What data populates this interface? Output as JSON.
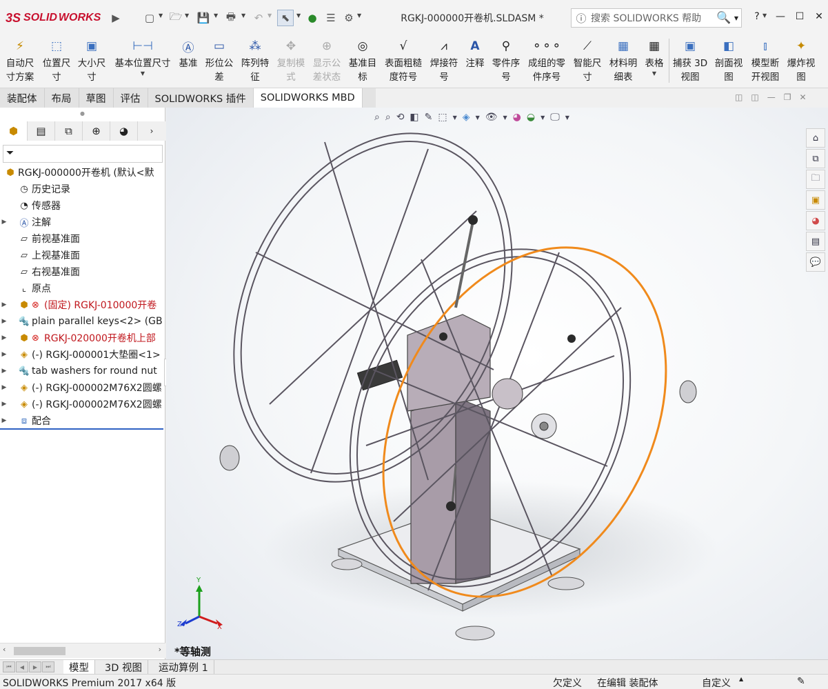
{
  "app": {
    "brand_ds": "3S",
    "brand_solid": "SOLID",
    "brand_works": "WORKS"
  },
  "titlebar": {
    "document_title": "RGKJ-000000开卷机.SLDASM *",
    "search_placeholder": "搜索 SOLIDWORKS 帮助",
    "help_label": "?",
    "icons": [
      "new-document",
      "open",
      "save",
      "print",
      "undo",
      "select",
      "rebuild",
      "file-properties",
      "options"
    ]
  },
  "ribbon": {
    "buttons": [
      {
        "label": "自动尺\n寸方案",
        "icon": "auto-dimension-icon"
      },
      {
        "label": "位置尺\n寸",
        "icon": "location-dimension-icon"
      },
      {
        "label": "大小尺\n寸",
        "icon": "size-dimension-icon"
      },
      {
        "label": "基本位置尺寸",
        "icon": "basic-location-dimension-icon"
      },
      {
        "label": "基准",
        "icon": "datum-icon"
      },
      {
        "label": "形位公\n差",
        "icon": "geometric-tolerance-icon"
      },
      {
        "label": "阵列特\n征",
        "icon": "pattern-feature-icon"
      },
      {
        "label": "复制模\n式",
        "icon": "copy-scheme-icon"
      },
      {
        "label": "显示公\n差状态",
        "icon": "show-tolerance-status-icon"
      },
      {
        "label": "基准目\n标",
        "icon": "datum-target-icon"
      },
      {
        "label": "表面粗糙\n度符号",
        "icon": "surface-finish-icon"
      },
      {
        "label": "焊接符\n号",
        "icon": "weld-symbol-icon"
      },
      {
        "label": "注释",
        "icon": "note-icon"
      },
      {
        "label": "零件序\n号",
        "icon": "balloon-icon"
      },
      {
        "label": "成组的零\n件序号",
        "icon": "stacked-balloon-icon"
      },
      {
        "label": "智能尺\n寸",
        "icon": "smart-dimension-icon"
      },
      {
        "label": "材料明\n细表",
        "icon": "bom-icon"
      },
      {
        "label": "表格",
        "icon": "table-icon"
      },
      {
        "label": "捕获 3D\n视图",
        "icon": "capture-3d-view-icon"
      },
      {
        "label": "剖面视\n图",
        "icon": "section-view-icon"
      },
      {
        "label": "模型断\n开视图",
        "icon": "model-break-view-icon"
      },
      {
        "label": "爆炸视\n图",
        "icon": "exploded-view-icon"
      }
    ]
  },
  "command_tabs": [
    "装配体",
    "布局",
    "草图",
    "评估",
    "SOLIDWORKS 插件",
    "SOLIDWORKS MBD"
  ],
  "active_command_tab": "SOLIDWORKS MBD",
  "feature_tree": {
    "root": "RGKJ-000000开卷机  (默认<默",
    "items": [
      {
        "label": "历史记录",
        "expandable": false,
        "icon": "history-icon"
      },
      {
        "label": "传感器",
        "expandable": false,
        "icon": "sensor-icon"
      },
      {
        "label": "注解",
        "expandable": true,
        "icon": "annotations-icon"
      },
      {
        "label": "前视基准面",
        "expandable": false,
        "icon": "plane-icon"
      },
      {
        "label": "上视基准面",
        "expandable": false,
        "icon": "plane-icon"
      },
      {
        "label": "右视基准面",
        "expandable": false,
        "icon": "plane-icon"
      },
      {
        "label": "原点",
        "expandable": false,
        "icon": "origin-icon"
      },
      {
        "label": "(固定) RGKJ-010000开卷",
        "expandable": true,
        "icon": "assembly-icon",
        "error": true
      },
      {
        "label": "plain parallel keys<2> (GB",
        "expandable": true,
        "icon": "toolbox-part-icon"
      },
      {
        "label": "RGKJ-020000开卷机上部",
        "expandable": true,
        "icon": "assembly-icon",
        "error": true
      },
      {
        "label": "(-) RGKJ-000001大垫圈<1>",
        "expandable": true,
        "icon": "part-icon"
      },
      {
        "label": "tab washers for round nut",
        "expandable": true,
        "icon": "toolbox-part-icon"
      },
      {
        "label": "(-) RGKJ-000002M76X2圆螺",
        "expandable": true,
        "icon": "part-icon"
      },
      {
        "label": "(-) RGKJ-000002M76X2圆螺",
        "expandable": true,
        "icon": "part-icon"
      },
      {
        "label": "配合",
        "expandable": true,
        "icon": "mates-icon"
      }
    ]
  },
  "viewport": {
    "view_label": "*等轴测",
    "triad": {
      "x": "X",
      "y": "Y",
      "z": "Z"
    }
  },
  "bottom_tabs": [
    "模型",
    "3D 视图",
    "运动算例 1"
  ],
  "active_bottom_tab": "模型",
  "status": {
    "product": "SOLIDWORKS Premium 2017 x64 版",
    "definition": "欠定义",
    "mode": "在编辑 装配体",
    "units": "自定义"
  },
  "colors": {
    "accent": "#2f61c3",
    "error": "#d4201c",
    "selection": "#f08a1c"
  }
}
